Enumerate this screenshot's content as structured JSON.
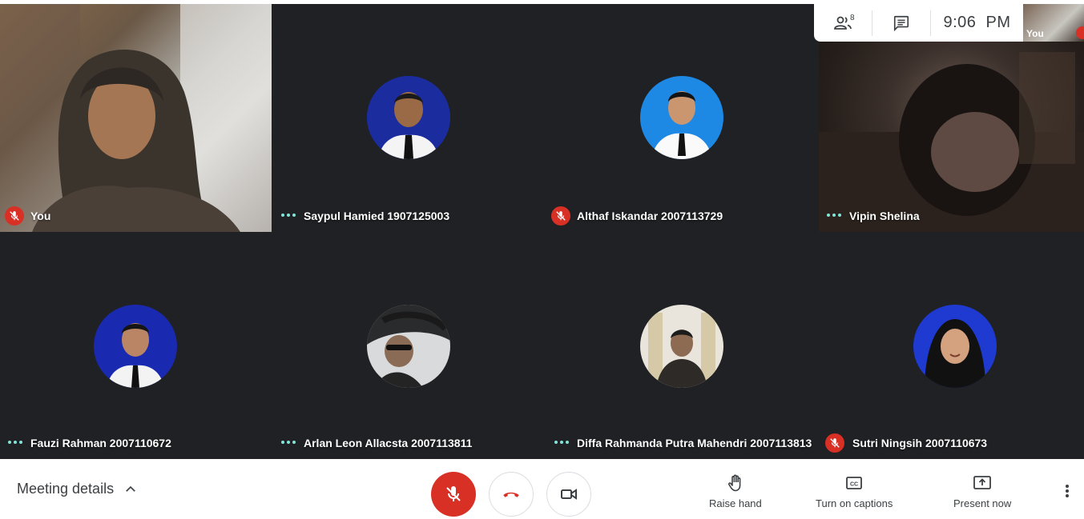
{
  "header": {
    "participants_count": "8",
    "time": "9:06  PM",
    "self_view_label": "You"
  },
  "participants": [
    {
      "name": "You",
      "status": "muted",
      "media": "video"
    },
    {
      "name": "Saypul Hamied 1907125003",
      "status": "speaking-dots",
      "media": "avatar"
    },
    {
      "name": "Althaf Iskandar 2007113729",
      "status": "muted",
      "media": "avatar"
    },
    {
      "name": "Vipin Shelina",
      "status": "speaking-dots",
      "media": "video"
    },
    {
      "name": "Fauzi Rahman 2007110672",
      "status": "speaking-dots",
      "media": "avatar"
    },
    {
      "name": "Arlan Leon Allacsta 2007113811",
      "status": "speaking-dots",
      "media": "avatar"
    },
    {
      "name": "Diffa Rahmanda Putra Mahendri 2007113813",
      "status": "speaking-dots",
      "media": "avatar"
    },
    {
      "name": "Sutri Ningsih 2007110673",
      "status": "muted",
      "media": "avatar"
    }
  ],
  "bottombar": {
    "meeting_details_label": "Meeting details",
    "raise_hand_label": "Raise hand",
    "captions_label": "Turn on captions",
    "present_label": "Present now"
  },
  "icons": {
    "participants": "people-icon",
    "chat": "chat-icon",
    "mic": "mic-off-icon",
    "hangup": "hangup-icon",
    "camera": "camera-icon",
    "raise_hand": "hand-icon",
    "captions": "cc-icon",
    "present": "present-icon",
    "more": "more-vert-icon"
  },
  "colors": {
    "background": "#202124",
    "muted_red": "#d93025",
    "dots_teal": "#81e6d9",
    "toolbar_text": "#3c4043"
  }
}
